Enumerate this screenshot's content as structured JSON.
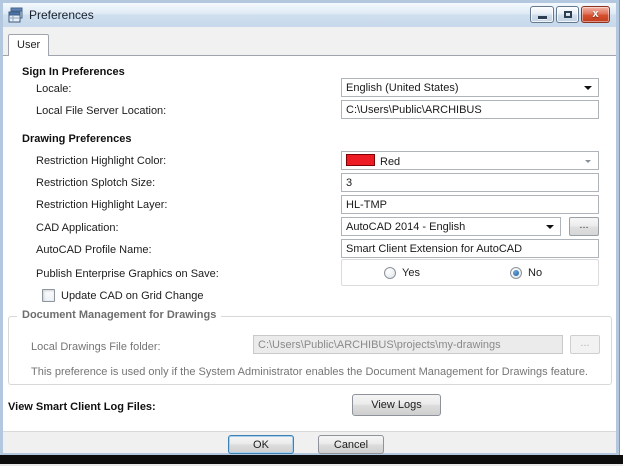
{
  "window": {
    "title": "Preferences",
    "min_label": "minimize",
    "max_label": "maximize",
    "close_label": "close"
  },
  "tabs": [
    {
      "label": "User"
    }
  ],
  "sign_in": {
    "heading": "Sign In Preferences",
    "locale_label": "Locale:",
    "locale_value": "English (United States)",
    "file_server_label": "Local File Server Location:",
    "file_server_value": "C:\\Users\\Public\\ARCHIBUS"
  },
  "drawing": {
    "heading": "Drawing Preferences",
    "highlight_color_label": "Restriction Highlight Color:",
    "highlight_color_value": "Red",
    "highlight_color_hex": "#ed1c24",
    "splotch_size_label": "Restriction Splotch Size:",
    "splotch_size_value": "3",
    "highlight_layer_label": "Restriction Highlight Layer:",
    "highlight_layer_value": "HL-TMP",
    "cad_app_label": "CAD Application:",
    "cad_app_value": "AutoCAD 2014 - English",
    "cad_browse_label": "...",
    "profile_label": "AutoCAD Profile Name:",
    "profile_value": "Smart Client Extension for AutoCAD",
    "publish_label": "Publish Enterprise Graphics on Save:",
    "radio_yes_label": "Yes",
    "radio_no_label": "No",
    "radio_selected": "No",
    "update_cad_label": "Update CAD on Grid Change",
    "update_cad_checked": "unchecked"
  },
  "doc_mgmt": {
    "heading": "Document Management for Drawings",
    "folder_label": "Local Drawings File folder:",
    "folder_value": "C:\\Users\\Public\\ARCHIBUS\\projects\\my-drawings",
    "browse_label": "...",
    "note": "This preference is used only if the System Administrator enables the Document Management for Drawings feature."
  },
  "logs": {
    "label": "View Smart Client Log Files:",
    "button_label": "View Logs"
  },
  "footer": {
    "ok_label": "OK",
    "cancel_label": "Cancel"
  }
}
